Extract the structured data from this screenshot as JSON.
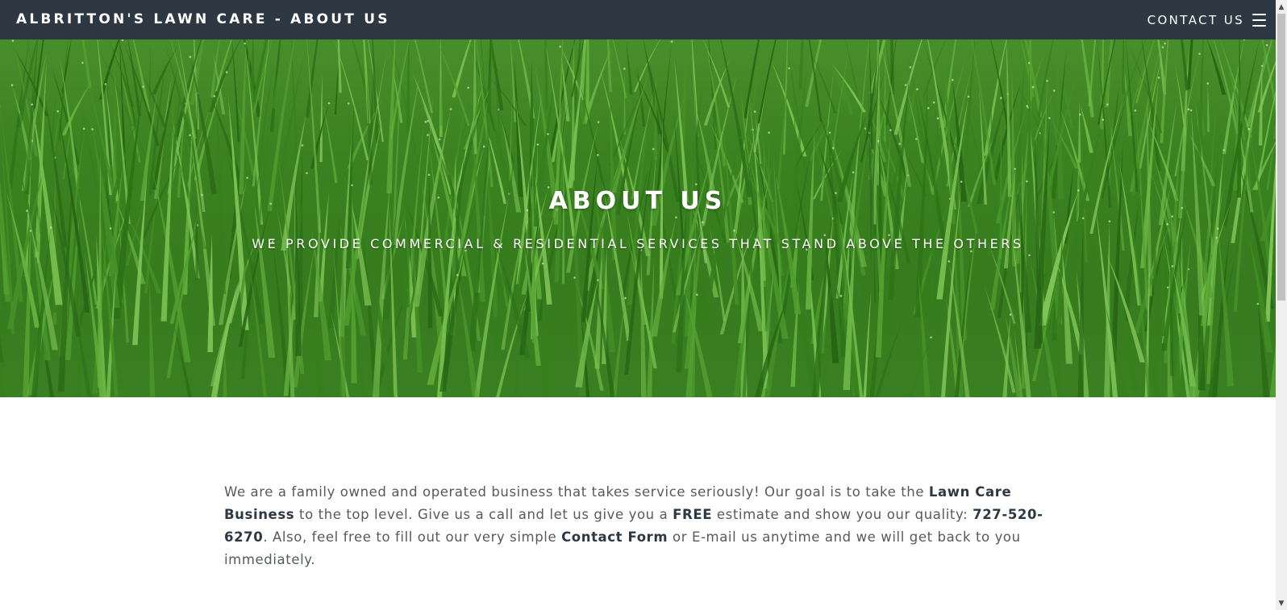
{
  "header": {
    "brand": "ALBRITTON'S LAWN CARE - ABOUT US",
    "contact_link": "CONTACT US",
    "menu_icon": "hamburger-menu-icon",
    "background_color": "#2e3842"
  },
  "hero": {
    "title": "ABOUT US",
    "subtitle": "WE PROVIDE COMMERCIAL & RESIDENTIAL SERVICES THAT STAND ABOVE THE OTHERS",
    "background": "green grass photo"
  },
  "content": {
    "part1": "We are a family owned and operated business that takes service seriously! Our goal is to take the ",
    "bold1": "Lawn Care Business",
    "part2": " to the top level. Give us a call and let us give you a ",
    "bold2": "FREE",
    "part3": " estimate and show you our quality: ",
    "phone": "727-520-6270",
    "part4": ". Also, feel free to fill out our very simple ",
    "contact_form_link": "Contact Form",
    "part5": " or E-mail us anytime and we will get back to you immediately."
  },
  "scrollbar": {
    "up_icon": "chevron-up-icon",
    "down_icon": "chevron-down-icon"
  }
}
